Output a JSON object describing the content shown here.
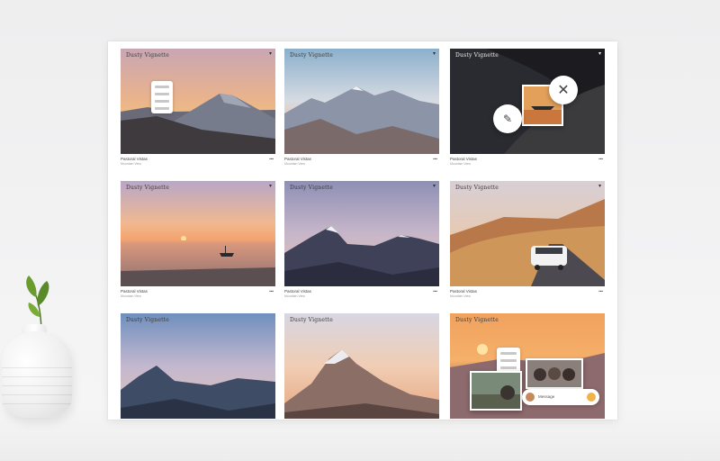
{
  "board": {
    "cards": [
      {
        "title": "Dusty Vignette",
        "meta": "Pastoral Vistas",
        "sub": "Mountain View",
        "action": "•••"
      },
      {
        "title": "Dusty Vignette",
        "meta": "Pastoral Vistas",
        "sub": "Mountain View",
        "action": "•••"
      },
      {
        "title": "Dusty Vignette",
        "meta": "Pastoral Vistas",
        "sub": "Mountain View",
        "action": "•••"
      },
      {
        "title": "Dusty Vignette",
        "meta": "Pastoral Vistas",
        "sub": "Mountain View",
        "action": "•••"
      },
      {
        "title": "Dusty Vignette",
        "meta": "Pastoral Vistas",
        "sub": "Mountain View",
        "action": "•••"
      },
      {
        "title": "Dusty Vignette",
        "meta": "Pastoral Vistas",
        "sub": "Mountain View",
        "action": "•••"
      },
      {
        "title": "Dusty Vignette"
      },
      {
        "title": "Dusty Vignette"
      },
      {
        "title": "Dusty Vignette"
      }
    ],
    "chat_bar": {
      "text": "Message"
    }
  },
  "icons": {
    "close": "close-icon",
    "edit": "pencil-icon",
    "menu": "chevron-down-icon"
  },
  "colors": {
    "board_bg": "#ffffff",
    "wall": "#efefef",
    "leaf": "#5a8a2a"
  }
}
